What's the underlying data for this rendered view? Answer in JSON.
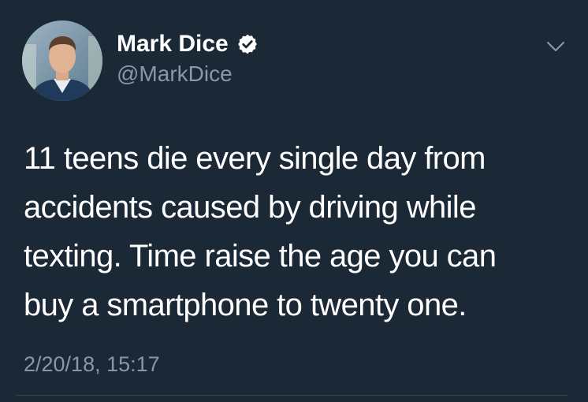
{
  "author": {
    "name": "Mark Dice",
    "handle": "@MarkDice",
    "verified": true
  },
  "tweet": {
    "text": "11 teens die every single day from\naccidents caused by driving while\ntexting.  Time raise the age you can\nbuy a smartphone to twenty one.",
    "timestamp": "2/20/18, 15:17"
  },
  "icons": {
    "verified": "verified-badge-icon",
    "menu": "chevron-down-icon"
  },
  "colors": {
    "background": "#1b2836",
    "text": "#ffffff",
    "secondary_text": "#8899a6",
    "divider": "#38444d"
  }
}
